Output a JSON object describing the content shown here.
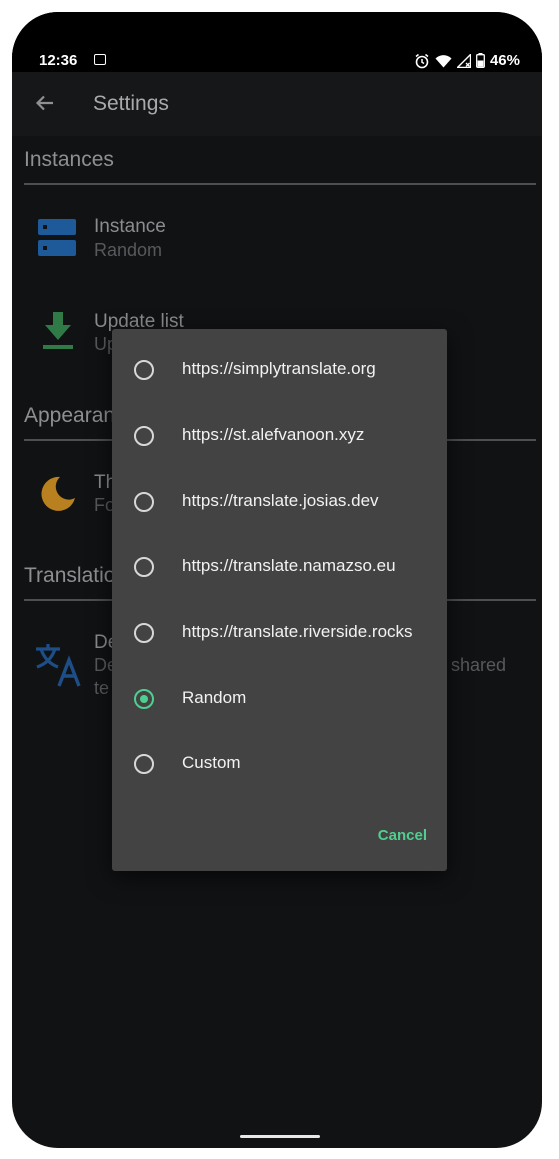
{
  "status": {
    "time": "12:36",
    "battery": "46%"
  },
  "appbar": {
    "title": "Settings"
  },
  "sections": {
    "instances": "Instances",
    "appearance": "Appearance",
    "translation": "Translation"
  },
  "prefs": {
    "instance": {
      "title": "Instance",
      "subtitle": "Random"
    },
    "update_list": {
      "title": "Update list",
      "subtitle": "Up"
    },
    "theme": {
      "title": "Th",
      "subtitle": "Fo"
    },
    "default": {
      "title": "De",
      "subtitle": "De",
      "subtitle_tail": "shared",
      "subtitle_line2": "te"
    }
  },
  "dialog": {
    "options": [
      {
        "label": "https://simplytranslate.org",
        "selected": false
      },
      {
        "label": "https://st.alefvanoon.xyz",
        "selected": false
      },
      {
        "label": "https://translate.josias.dev",
        "selected": false
      },
      {
        "label": "https://translate.namazso.eu",
        "selected": false
      },
      {
        "label": "https://translate.riverside.rocks",
        "selected": false
      },
      {
        "label": "Random",
        "selected": true
      },
      {
        "label": "Custom",
        "selected": false
      }
    ],
    "cancel_label": "Cancel"
  },
  "colors": {
    "accent": "#4fcf8f",
    "dialog_bg": "#434343",
    "screen_bg": "#111214",
    "instance_icon": "#1e5a9a",
    "update_icon": "#2f7a46",
    "theme_icon": "#b8801e",
    "translate_icon": "#1e4e88"
  },
  "icons": [
    "image-icon",
    "alarm-icon",
    "wifi-icon",
    "signal-icon",
    "battery-icon",
    "back-arrow-icon",
    "server-icon",
    "download-icon",
    "moon-icon",
    "translate-icon"
  ]
}
